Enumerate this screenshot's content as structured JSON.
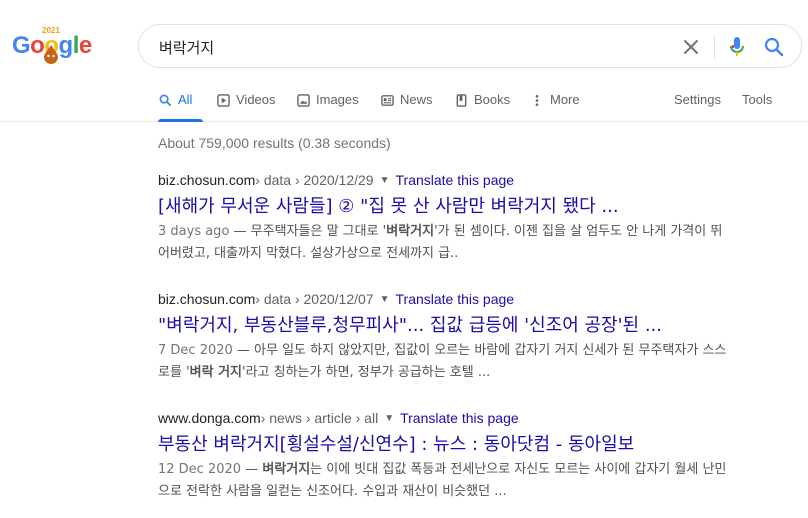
{
  "logo": {
    "letters": [
      "G",
      "o",
      "o",
      "g",
      "l",
      "e"
    ],
    "year": "2021",
    "colors": [
      "#4285f4",
      "#ea4335",
      "#fbbc05",
      "#4285f4",
      "#34a853",
      "#ea4335"
    ]
  },
  "search": {
    "query": "벼락거지",
    "clear_icon": "close-icon",
    "mic_icon": "mic-icon",
    "search_icon": "search-icon"
  },
  "tabs": {
    "all": "All",
    "videos": "Videos",
    "images": "Images",
    "news": "News",
    "books": "Books",
    "more": "More",
    "settings": "Settings",
    "tools": "Tools"
  },
  "stats": "About 759,000 results (0.38 seconds)",
  "results": [
    {
      "domain": "biz.chosun.com",
      "path": " › data › 2020/12/29",
      "translate": "Translate this page",
      "title": "[새해가 무서운 사람들] ② \"집 못 산 사람만 벼락거지 됐다 ...",
      "date": "3 days ago",
      "snippet_pre": " — 무주택자들은 말 그대로 '",
      "snippet_bold": "벼락거지",
      "snippet_post": "'가 된 셈이다. 이젠 집을 살 엄두도 안 나게 가격이 뛰어버렸고, 대출까지 막혔다. 설상가상으로 전세까지 급.."
    },
    {
      "domain": "biz.chosun.com",
      "path": " › data › 2020/12/07",
      "translate": "Translate this page",
      "title": "\"벼락거지, 부동산블루,청무피사\"... 집값 급등에 '신조어 공장'된 ...",
      "date": "7 Dec 2020",
      "snippet_pre": " — 아무 일도 하지 않았지만, 집값이 오르는 바람에 갑자기 거지 신세가 된 무주택자가 스스로를 '",
      "snippet_bold": "벼락 거지",
      "snippet_post": "'라고 칭하는가 하면, 정부가 공급하는 호텔 ..."
    },
    {
      "domain": "www.donga.com",
      "path": " › news › article › all",
      "translate": "Translate this page",
      "title": "부동산 벼락거지[횡설수설/신연수] : 뉴스 : 동아닷컴 - 동아일보",
      "date": "12 Dec 2020",
      "snippet_pre": " — ",
      "snippet_bold": "벼락거지",
      "snippet_post": "는 이에 빗대 집값 폭등과 전세난으로 자신도 모르는 사이에 갑자기 월세 난민으로 전락한 사람을 일컫는 신조어다. 수입과 재산이 비슷했던 ..."
    }
  ]
}
